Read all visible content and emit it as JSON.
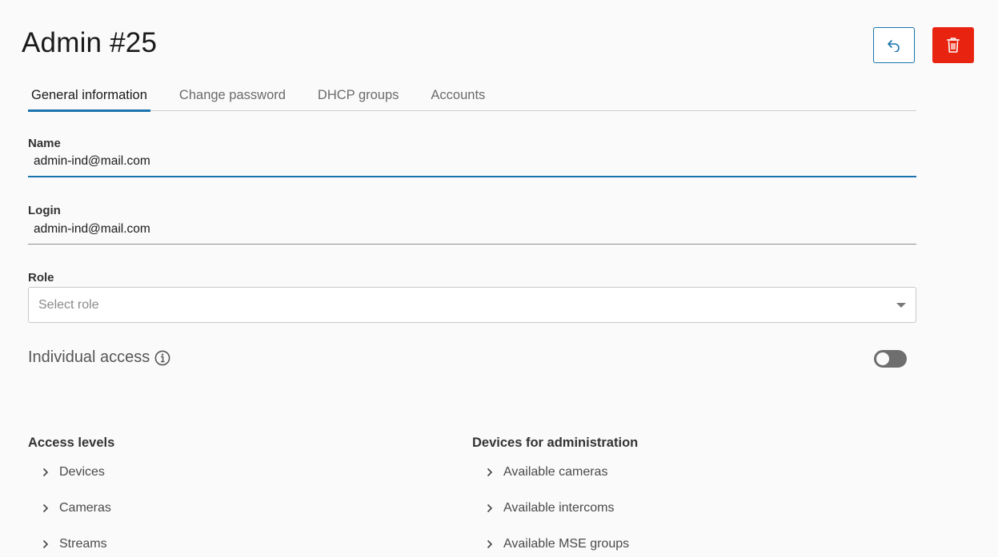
{
  "header": {
    "title": "Admin #25"
  },
  "tabs": [
    {
      "label": "General information",
      "active": true
    },
    {
      "label": "Change password",
      "active": false
    },
    {
      "label": "DHCP groups",
      "active": false
    },
    {
      "label": "Accounts",
      "active": false
    }
  ],
  "form": {
    "name": {
      "label": "Name",
      "value": "admin-ind@mail.com"
    },
    "login": {
      "label": "Login",
      "value": "admin-ind@mail.com"
    },
    "role": {
      "label": "Role",
      "placeholder": "Select role"
    },
    "individual_access": {
      "label": "Individual access",
      "enabled": false
    }
  },
  "access_levels": {
    "title": "Access levels",
    "items": [
      "Devices",
      "Cameras",
      "Streams"
    ]
  },
  "devices_admin": {
    "title": "Devices for administration",
    "items": [
      "Available cameras",
      "Available intercoms",
      "Available MSE groups"
    ]
  },
  "colors": {
    "accent": "#1a73ad",
    "danger": "#e8230f",
    "toggle_off": "#6e6e6e"
  }
}
